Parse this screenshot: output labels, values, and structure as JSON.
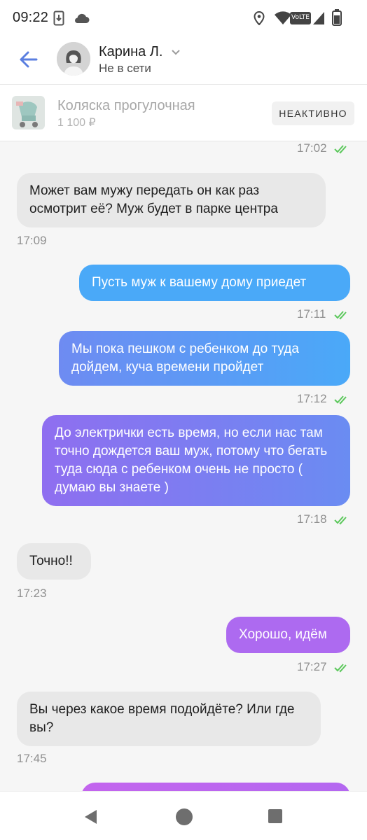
{
  "status_bar": {
    "time": "09:22",
    "icons": [
      "download-notification-icon",
      "cloud-icon",
      "location-icon",
      "wifi-icon",
      "volte-icon",
      "signal-icon",
      "battery-icon"
    ],
    "volte_label": "VoLTE"
  },
  "header": {
    "back_icon": "arrow-left-icon",
    "contact_name": "Карина Л.",
    "contact_status": "Не в сети",
    "accent": "#5b7fe0"
  },
  "ad": {
    "title": "Коляска прогулочная",
    "price": "1 100 ₽",
    "badge": "НЕАКТИВНО"
  },
  "messages": [
    {
      "dir": "out",
      "text": "",
      "time": "17:02",
      "read": true
    },
    {
      "dir": "in",
      "text": "Может вам мужу передать он как раз осмотрит её? Муж будет в парке центра",
      "time": "17:09"
    },
    {
      "dir": "out",
      "text": "Пусть муж к вашему дому приедет",
      "time": "17:11",
      "read": true
    },
    {
      "dir": "out",
      "text": "Мы пока пешком с ребенком до туда дойдем, куча времени пройдет",
      "time": "17:12",
      "read": true
    },
    {
      "dir": "out",
      "text": "До электрички есть время, но если нас там точно дождется ваш муж, потому что бегать туда сюда с ребенком очень не просто ( думаю вы знаете )",
      "time": "17:18",
      "read": true
    },
    {
      "dir": "in",
      "text": "Точно!!",
      "time": "17:23"
    },
    {
      "dir": "out",
      "text": "Хорошо, идём",
      "time": "17:27",
      "read": true
    },
    {
      "dir": "in",
      "text": "Вы через какое время подойдёте? Или где вы?",
      "time": "17:45"
    },
    {
      "dir": "out",
      "text": "",
      "time": "",
      "read": false
    }
  ],
  "colors": {
    "incoming_bubble": "#e8e8e8",
    "outgoing_blue": "#4aa9f8",
    "outgoing_purple": "#b468f0",
    "read_tick": "#5cc85c"
  },
  "nav_bar": {
    "icons": [
      "back-triangle-icon",
      "home-circle-icon",
      "recents-square-icon"
    ]
  }
}
